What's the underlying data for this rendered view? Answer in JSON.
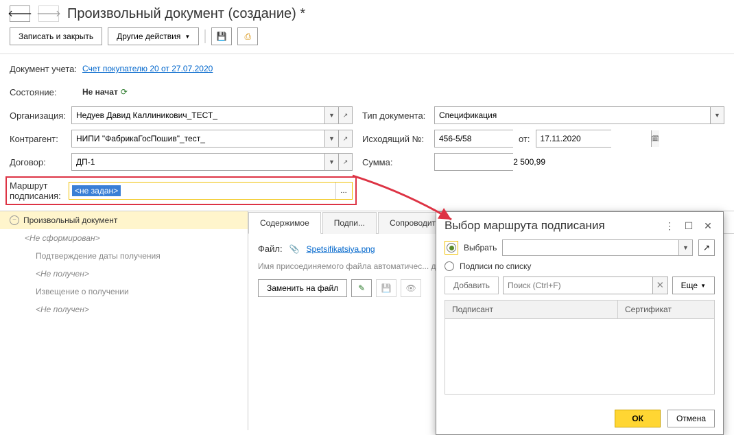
{
  "page_title": "Произвольный документ (создание) *",
  "toolbar": {
    "save_close": "Записать и закрыть",
    "other_actions": "Другие действия"
  },
  "doc_acc": {
    "label": "Документ учета:",
    "link": "Счет покупателю 20 от 27.07.2020"
  },
  "state": {
    "label": "Состояние:",
    "value": "Не начат"
  },
  "org": {
    "label": "Организация:",
    "value": "Недуев Давид Каллиникович_ТЕСТ_"
  },
  "doctype": {
    "label": "Тип документа:",
    "value": "Спецификация"
  },
  "counterparty": {
    "label": "Контрагент:",
    "value": "НИПИ \"ФабрикаГосПошив\"_тест_"
  },
  "out_no": {
    "label": "Исходящий №:",
    "value": "456-5/58",
    "date_label": "от:",
    "date": "17.11.2020"
  },
  "contract": {
    "label": "Договор:",
    "value": "ДП-1"
  },
  "sum": {
    "label": "Сумма:",
    "value": "2 500,99"
  },
  "route": {
    "label": "Маршрут подписания:",
    "value": "<не задан>"
  },
  "tree": {
    "root": "Произвольный документ",
    "root_sub": "<Не сформирован>",
    "item1": "Подтверждение даты получения",
    "item1_sub": "<Не получен>",
    "item2": "Извещение о получении",
    "item2_sub": "<Не получен>"
  },
  "tabs": {
    "content": "Содержимое",
    "sign": "Подпи...",
    "note": "Сопроводительная записка"
  },
  "file": {
    "label": "Файл:",
    "link": "Spetsifikatsiya.png"
  },
  "hint": "Имя присоединяемого файла автоматичес... для возможности переноса между различн...",
  "actions": {
    "replace": "Заменить на файл"
  },
  "dialog": {
    "title": "Выбор маршрута подписания",
    "opt_select": "Выбрать",
    "opt_list": "Подписи по списку",
    "add": "Добавить",
    "search_placeholder": "Поиск (Ctrl+F)",
    "more": "Еще",
    "col_signer": "Подписант",
    "col_cert": "Сертификат",
    "ok": "ОК",
    "cancel": "Отмена"
  }
}
